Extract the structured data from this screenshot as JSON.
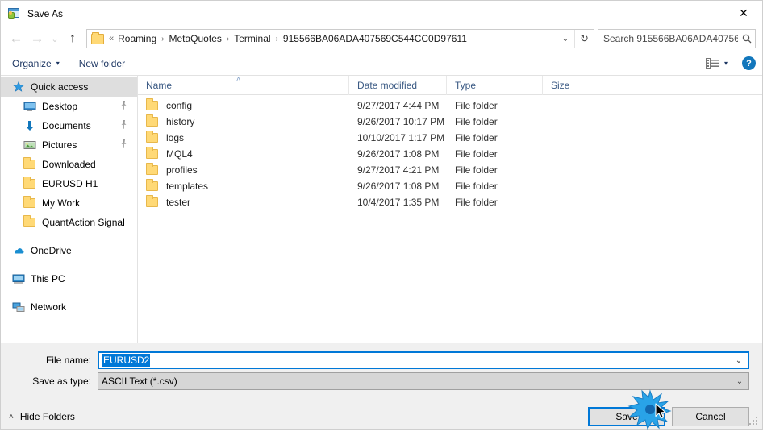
{
  "window": {
    "title": "Save As",
    "app_icon": "metatrader-icon",
    "close_label": "✕"
  },
  "nav": {
    "back_icon": "←",
    "forward_icon": "→",
    "recent_icon": "⌄",
    "up_icon": "↑",
    "address": {
      "lead": "«",
      "crumbs": [
        "Roaming",
        "MetaQuotes",
        "Terminal",
        "915566BA06ADA407569C544CC0D97611"
      ],
      "separator": "›",
      "dropdown_icon": "⌄",
      "refresh_icon": "↻"
    },
    "search": {
      "placeholder": "Search 915566BA06ADA40756...",
      "icon": "search-icon"
    }
  },
  "toolbar": {
    "organize_label": "Organize",
    "organize_caret": "▾",
    "new_folder_label": "New folder",
    "view_caret": "▾",
    "help_label": "?"
  },
  "sidebar": {
    "groups": [
      {
        "header": {
          "label": "Quick access",
          "icon": "star-icon",
          "selected": true
        },
        "items": [
          {
            "label": "Desktop",
            "icon": "monitor-icon",
            "pinned": true
          },
          {
            "label": "Documents",
            "icon": "download-arrow-icon",
            "pinned": true
          },
          {
            "label": "Pictures",
            "icon": "picture-icon",
            "pinned": true
          },
          {
            "label": "Downloaded",
            "icon": "folder-icon",
            "pinned": false
          },
          {
            "label": "EURUSD H1",
            "icon": "folder-icon",
            "pinned": false
          },
          {
            "label": "My Work",
            "icon": "folder-icon",
            "pinned": false
          },
          {
            "label": "QuantAction Signal",
            "icon": "folder-icon",
            "pinned": false
          }
        ]
      }
    ],
    "roots": [
      {
        "label": "OneDrive",
        "icon": "cloud-icon"
      },
      {
        "label": "This PC",
        "icon": "pc-icon"
      },
      {
        "label": "Network",
        "icon": "network-icon"
      }
    ],
    "pin_glyph": "📌"
  },
  "filelist": {
    "columns": [
      "Name",
      "Date modified",
      "Type",
      "Size"
    ],
    "sort_caret": "˄",
    "rows": [
      {
        "name": "config",
        "date": "9/27/2017 4:44 PM",
        "type": "File folder",
        "size": ""
      },
      {
        "name": "history",
        "date": "9/26/2017 10:17 PM",
        "type": "File folder",
        "size": ""
      },
      {
        "name": "logs",
        "date": "10/10/2017 1:17 PM",
        "type": "File folder",
        "size": ""
      },
      {
        "name": "MQL4",
        "date": "9/26/2017 1:08 PM",
        "type": "File folder",
        "size": ""
      },
      {
        "name": "profiles",
        "date": "9/27/2017 4:21 PM",
        "type": "File folder",
        "size": ""
      },
      {
        "name": "templates",
        "date": "9/26/2017 1:08 PM",
        "type": "File folder",
        "size": ""
      },
      {
        "name": "tester",
        "date": "10/4/2017 1:35 PM",
        "type": "File folder",
        "size": ""
      }
    ]
  },
  "form": {
    "filename_label": "File name:",
    "filename_value": "EURUSD2",
    "filetype_label": "Save as type:",
    "filetype_value": "ASCII Text (*.csv)",
    "chevron": "⌄"
  },
  "actions": {
    "hide_folders_label": "Hide Folders",
    "hide_folders_caret": "˄",
    "save_label": "Save",
    "cancel_label": "Cancel"
  },
  "colors": {
    "accent": "#0078d7",
    "toolbar_text": "#1f3864",
    "header_text": "#3b5a84",
    "folder": "#ffd976",
    "help_blue": "#1277bc",
    "selection": "#dedede"
  }
}
